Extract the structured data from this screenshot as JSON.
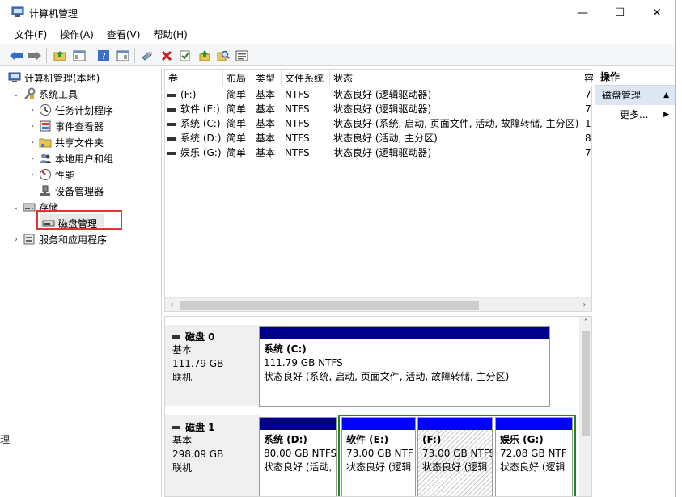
{
  "window": {
    "title": "计算机管理",
    "minimize": "—",
    "maximize": "☐",
    "close": "✕"
  },
  "menu": [
    "文件(F)",
    "操作(A)",
    "查看(V)",
    "帮助(H)"
  ],
  "tree": {
    "root": "计算机管理(本地)",
    "system_tools": "系统工具",
    "task_scheduler": "任务计划程序",
    "event_viewer": "事件查看器",
    "shared_folders": "共享文件夹",
    "local_users": "本地用户和组",
    "performance": "性能",
    "device_manager": "设备管理器",
    "storage": "存储",
    "disk_management": "磁盘管理",
    "services": "服务和应用程序"
  },
  "volume_table": {
    "headers": [
      "卷",
      "布局",
      "类型",
      "文件系统",
      "状态",
      "容"
    ],
    "rows": [
      {
        "vol": "(F:)",
        "layout": "简单",
        "type": "基本",
        "fs": "NTFS",
        "status": "状态良好 (逻辑驱动器)",
        "cap": "7"
      },
      {
        "vol": "软件 (E:)",
        "layout": "简单",
        "type": "基本",
        "fs": "NTFS",
        "status": "状态良好 (逻辑驱动器)",
        "cap": "7"
      },
      {
        "vol": "系统 (C:)",
        "layout": "简单",
        "type": "基本",
        "fs": "NTFS",
        "status": "状态良好 (系统, 启动, 页面文件, 活动, 故障转储, 主分区)",
        "cap": "1"
      },
      {
        "vol": "系统 (D:)",
        "layout": "简单",
        "type": "基本",
        "fs": "NTFS",
        "status": "状态良好 (活动, 主分区)",
        "cap": "8"
      },
      {
        "vol": "娱乐 (G:)",
        "layout": "简单",
        "type": "基本",
        "fs": "NTFS",
        "status": "状态良好 (逻辑驱动器)",
        "cap": "7"
      }
    ]
  },
  "disks": [
    {
      "name": "磁盘 0",
      "kind": "基本",
      "size": "111.79 GB",
      "state": "联机",
      "partitions": [
        {
          "title": "系统 (C:)",
          "size": "111.79 GB NTFS",
          "status": "状态良好 (系统, 启动, 页面文件, 活动, 故障转储, 主分区)"
        }
      ]
    },
    {
      "name": "磁盘 1",
      "kind": "基本",
      "size": "298.09 GB",
      "state": "联机",
      "partitions": [
        {
          "title": "系统 (D:)",
          "size": "80.00 GB NTFS",
          "status": "状态良好 (活动,"
        },
        {
          "title": "软件 (E:)",
          "size": "73.00 GB NTF",
          "status": "状态良好 (逻辑"
        },
        {
          "title": "(F:)",
          "size": "73.00 GB NTFS",
          "status": "状态良好 (逻辑"
        },
        {
          "title": "娱乐 (G:)",
          "size": "72.08 GB NTF",
          "status": "状态良好 (逻辑"
        }
      ]
    }
  ],
  "actions": {
    "header": "操作",
    "section": "磁盘管理",
    "more": "更多..."
  },
  "edge_text": "理",
  "colors": {
    "primary_partition_bar": "#00008b",
    "logical_partition_bar": "#0000ff",
    "extended_border": "#1a8a1a",
    "selection_highlight": "#e63232",
    "action_section_bg": "#dde7f3"
  }
}
